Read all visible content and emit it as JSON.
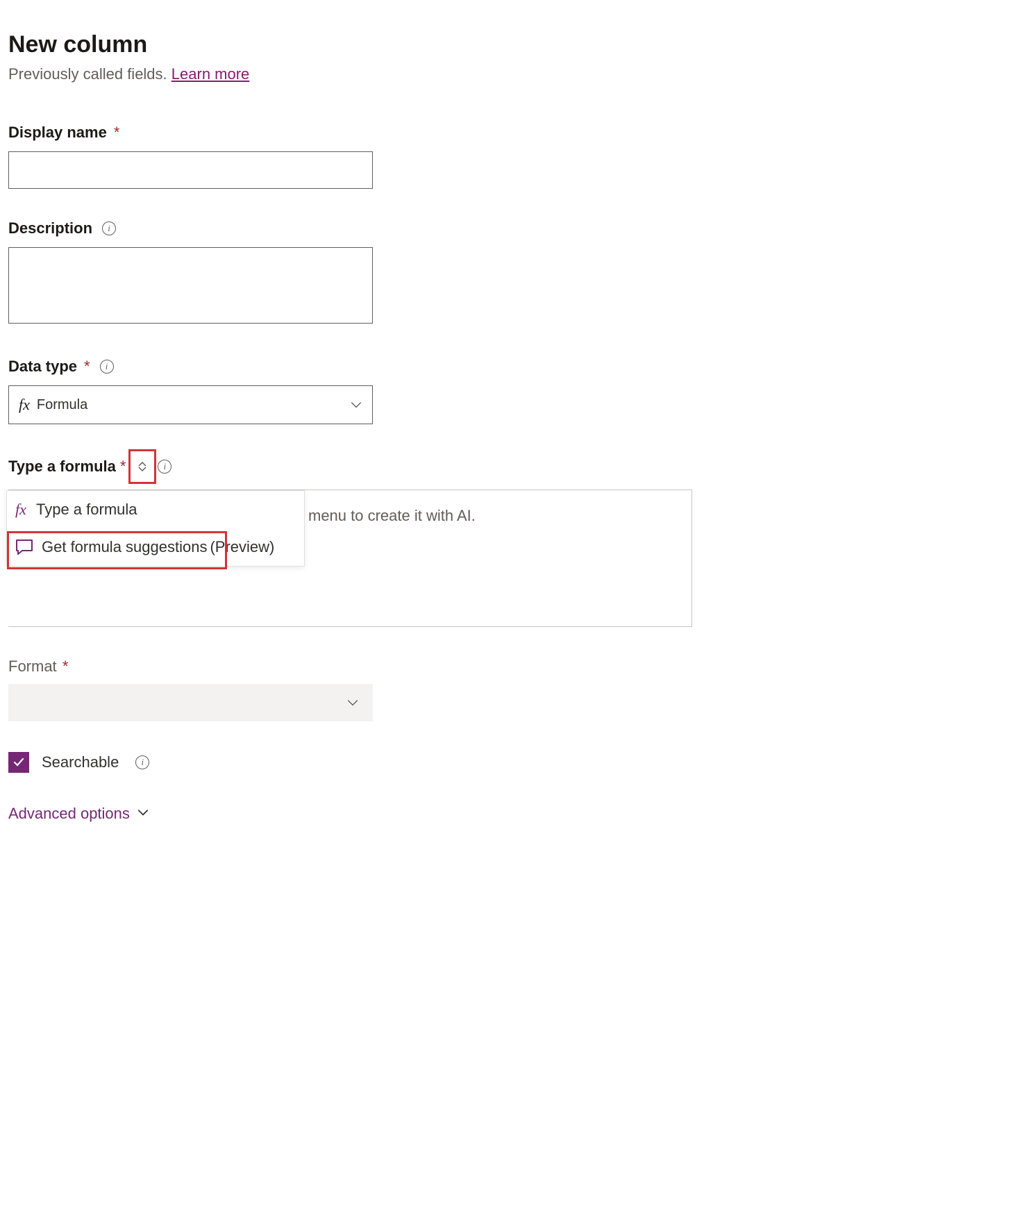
{
  "header": {
    "title": "New column",
    "subtitle_prefix": "Previously called fields. ",
    "learn_more": "Learn more"
  },
  "fields": {
    "display_name": {
      "label": "Display name",
      "value": ""
    },
    "description": {
      "label": "Description",
      "value": ""
    },
    "data_type": {
      "label": "Data type",
      "value": "Formula"
    },
    "formula": {
      "label": "Type a formula",
      "placeholder_suffix": "menu to create it with AI.",
      "menu": {
        "type_option": "Type a formula",
        "suggest_option": "Get formula suggestions",
        "suggest_suffix": "(Preview)"
      }
    },
    "format": {
      "label": "Format",
      "value": ""
    },
    "searchable": {
      "label": "Searchable",
      "checked": true
    }
  },
  "links": {
    "advanced": "Advanced options"
  },
  "required_marker": "*"
}
